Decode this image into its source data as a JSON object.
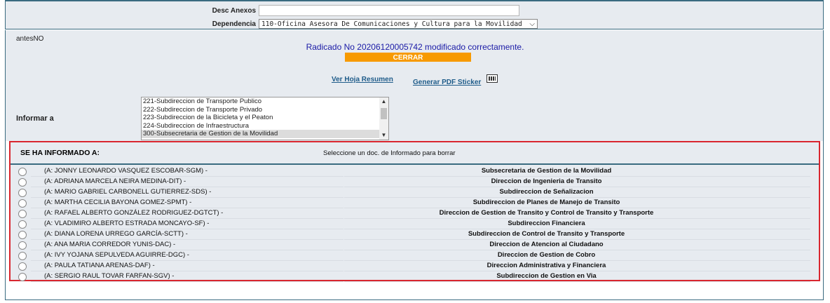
{
  "form": {
    "desc_anexos_label": "Desc Anexos",
    "desc_anexos_value": "",
    "dependencia_label": "Dependencia",
    "dependencia_value": "110-Oficina Asesora De Comunicaciones y Cultura para la Movilidad"
  },
  "status": {
    "antes": "antesNO",
    "message": "Radicado No 20206120005742 modificado correctamente.",
    "close_label": "CERRAR",
    "ver_hoja_label": "Ver Hoja Resumen",
    "generar_pdf_label": "Generar PDF Sticker"
  },
  "informar": {
    "label": "Informar a",
    "options": [
      "221-Subdireccion de Transporte Publico",
      "222-Subdireccion de Transporte Privado",
      "223-Subdireccion de la Bicicleta y el Peaton",
      "224-Subdireccion de Infraestructura",
      "300-Subsecretaria de Gestion de la Movilidad"
    ],
    "selected_index": 4
  },
  "informados": {
    "title": "SE HA INFORMADO A:",
    "hint": "Seleccione un doc. de Informado para borrar",
    "rows": [
      {
        "who": "(A: JONNY LEONARDO VASQUEZ ESCOBAR-SGM) -",
        "dep": "Subsecretaria de Gestion de la Movilidad"
      },
      {
        "who": "(A: ADRIANA MARCELA NEIRA MEDINA-DIT) -",
        "dep": "Direccion de Ingenieria de Transito"
      },
      {
        "who": "(A: MARIO GABRIEL CARBONELL GUTIERREZ-SDS) -",
        "dep": "Subdireccion de Señalizacion"
      },
      {
        "who": "(A: MARTHA CECILIA BAYONA GOMEZ-SPMT) -",
        "dep": "Subdireccion de Planes de Manejo de Transito"
      },
      {
        "who": "(A: RAFAEL ALBERTO GONZÁLEZ RODRIGUEZ-DGTCT) -",
        "dep": "Direccion de Gestion de Transito y Control de Transito y Transporte"
      },
      {
        "who": "(A: VLADIMIRO ALBERTO ESTRADA MONCAYO-SF) -",
        "dep": "Subdireccion Financiera"
      },
      {
        "who": "(A: DIANA LORENA URREGO GARCÍA-SCTT) -",
        "dep": "Subdireccion de Control de Transito y Transporte"
      },
      {
        "who": "(A: ANA MARIA CORREDOR YUNIS-DAC) -",
        "dep": "Direccion de Atencion al Ciudadano"
      },
      {
        "who": "(A: IVY YOJANA SEPULVEDA AGUIRRE-DGC) -",
        "dep": "Direccion de Gestion de Cobro"
      },
      {
        "who": "(A: PAULA TATIANA ARENAS-DAF) -",
        "dep": "Direccion Administrativa y Financiera"
      },
      {
        "who": "(A: SERGIO RAUL TOVAR FARFAN-SGV) -",
        "dep": "Subdireccion de Gestion en Via"
      }
    ]
  },
  "colors": {
    "accent_orange": "#f79a00",
    "highlight_red": "#d9262f",
    "link_blue": "#1f5c8a"
  }
}
